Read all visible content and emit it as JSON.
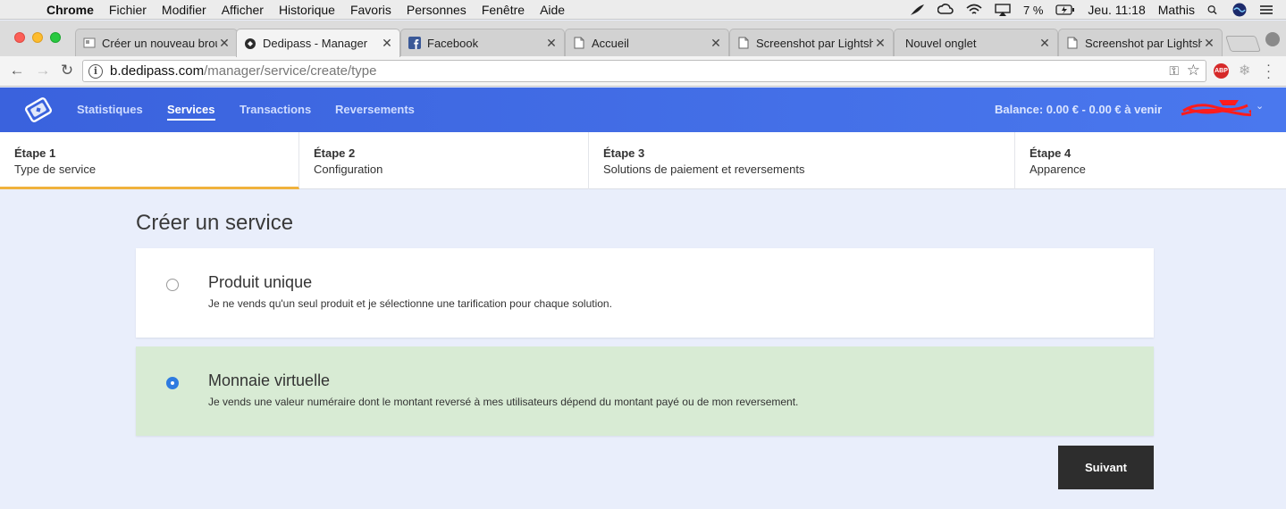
{
  "menubar": {
    "app": "Chrome",
    "items": [
      "Fichier",
      "Modifier",
      "Afficher",
      "Historique",
      "Favoris",
      "Personnes",
      "Fenêtre",
      "Aide"
    ],
    "battery": "7 %",
    "clock": "Jeu. 11:18",
    "user": "Mathis"
  },
  "tabs": [
    {
      "title": "Créer un nouveau brou",
      "favicon": "doc-icon"
    },
    {
      "title": "Dedipass - Manager",
      "favicon": "dedipass-icon"
    },
    {
      "title": "Facebook",
      "favicon": "facebook-icon"
    },
    {
      "title": "Accueil",
      "favicon": "page-icon"
    },
    {
      "title": "Screenshot par Lightsh",
      "favicon": "page-icon"
    },
    {
      "title": "Nouvel onglet",
      "favicon": "none"
    },
    {
      "title": "Screenshot par Lightsh",
      "favicon": "page-icon"
    }
  ],
  "address": {
    "host": "b.dedipass.com",
    "path": "/manager/service/create/type"
  },
  "nav": {
    "items": [
      "Statistiques",
      "Services",
      "Transactions",
      "Reversements"
    ],
    "active": "Services",
    "balance": "Balance: 0.00 € - 0.00 € à venir"
  },
  "steps": [
    {
      "num": "Étape 1",
      "label": "Type de service"
    },
    {
      "num": "Étape 2",
      "label": "Configuration"
    },
    {
      "num": "Étape 3",
      "label": "Solutions de paiement et reversements"
    },
    {
      "num": "Étape 4",
      "label": "Apparence"
    }
  ],
  "main": {
    "title": "Créer un service",
    "options": [
      {
        "title": "Produit unique",
        "desc": "Je ne vends qu'un seul produit et je sélectionne une tarification pour chaque solution.",
        "selected": false
      },
      {
        "title": "Monnaie virtuelle",
        "desc": "Je vends une valeur numéraire dont le montant reversé à mes utilisateurs dépend du montant payé ou de mon reversement.",
        "selected": true
      }
    ],
    "next_label": "Suivant"
  },
  "colors": {
    "header": "#3a62dd",
    "step_active": "#f0b23d",
    "selected_option": "#d8ebd4",
    "radio_checked": "#2e7be0",
    "button": "#2d2d2d"
  }
}
